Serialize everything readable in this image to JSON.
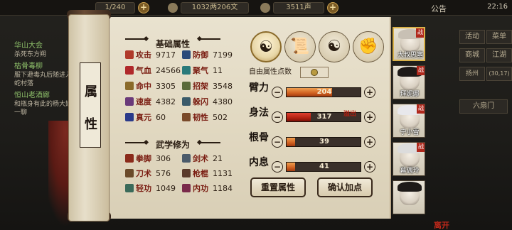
{
  "topbar": {
    "stamina": "1/240",
    "coins": "1032两206文",
    "reputation": "3511声",
    "announcement": "公告",
    "time": "22:16"
  },
  "quests": [
    {
      "title": "华山大会",
      "desc": "杀死东方朔"
    },
    {
      "title": "枯骨毒柳",
      "desc": "服下避毒丸后随进入捕蛇村落"
    },
    {
      "title": "恒山老酒廊",
      "desc": "和瓶身有此的杨大娘上一聊"
    }
  ],
  "right_menu": [
    "活动",
    "菜单",
    "商城",
    "江湖",
    "扬州",
    "(30,17)",
    "六扇门"
  ],
  "scroll": {
    "title_chars": [
      "属",
      "性"
    ]
  },
  "base_attrs": {
    "header": "基础属性",
    "items": [
      {
        "label": "攻击",
        "value": "9717",
        "icon_color": "#b03a2a"
      },
      {
        "label": "防御",
        "value": "7199",
        "icon_color": "#2a4a7a"
      },
      {
        "label": "气血",
        "value": "24566",
        "icon_color": "#b0282a"
      },
      {
        "label": "聚气",
        "value": "11",
        "icon_color": "#2a7a7a"
      },
      {
        "label": "命中",
        "value": "3305",
        "icon_color": "#8a6a2a"
      },
      {
        "label": "招架",
        "value": "3548",
        "icon_color": "#5a6a3a"
      },
      {
        "label": "速度",
        "value": "4382",
        "icon_color": "#6a3a7a"
      },
      {
        "label": "躲闪",
        "value": "4380",
        "icon_color": "#3a5a6a"
      },
      {
        "label": "真元",
        "value": "60",
        "icon_color": "#2a3a8a"
      },
      {
        "label": "韧性",
        "value": "502",
        "icon_color": "#7a4a2a"
      }
    ]
  },
  "martial": {
    "header": "武学修为",
    "items": [
      {
        "label": "拳脚",
        "value": "306",
        "icon_color": "#8a2a1a"
      },
      {
        "label": "剑术",
        "value": "21",
        "icon_color": "#4a5a6a"
      },
      {
        "label": "刀术",
        "value": "576",
        "icon_color": "#6a4a2a"
      },
      {
        "label": "枪棍",
        "value": "1131",
        "icon_color": "#5a3a2a"
      },
      {
        "label": "轻功",
        "value": "1049",
        "icon_color": "#3a6a5a"
      },
      {
        "label": "内功",
        "value": "1184",
        "icon_color": "#7a2a4a"
      }
    ]
  },
  "attr_icons": [
    "sage-icon",
    "scroll-icon",
    "taiji-icon",
    "fist-icon"
  ],
  "free_points": {
    "label": "自由属性点数"
  },
  "allocation": {
    "overflow_label": "溢出",
    "rows": [
      {
        "label": "臂力",
        "value": "204",
        "fill": 0.62,
        "over": false
      },
      {
        "label": "身法",
        "value": "317",
        "fill": 0.33,
        "over": true
      },
      {
        "label": "根骨",
        "value": "39",
        "fill": 0.12,
        "over": false
      },
      {
        "label": "内息",
        "value": "41",
        "fill": 0.12,
        "over": false
      }
    ]
  },
  "buttons": {
    "reset": "重置属性",
    "confirm": "确认加点"
  },
  "characters": [
    {
      "name": "大叔思塞",
      "tag": "战"
    },
    {
      "name": "拜妮娜",
      "tag": "战"
    },
    {
      "name": "宁小雪",
      "tag": "战"
    },
    {
      "name": "幕偶玲",
      "tag": "战"
    },
    {
      "name": "",
      "tag": ""
    }
  ],
  "dizi_label": "离开"
}
